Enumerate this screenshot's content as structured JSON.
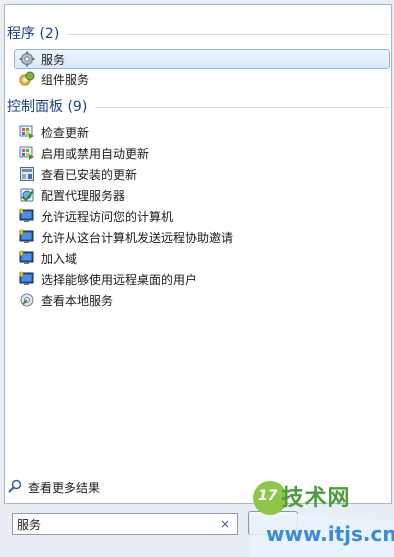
{
  "programs": {
    "header": "程序 (2)",
    "items": [
      {
        "label": "服务",
        "icon": "services-gear-icon",
        "selected": true
      },
      {
        "label": "组件服务",
        "icon": "component-services-icon",
        "selected": false
      }
    ]
  },
  "control_panel": {
    "header": "控制面板 (9)",
    "items": [
      {
        "label": "检查更新",
        "icon": "windows-update-icon"
      },
      {
        "label": "启用或禁用自动更新",
        "icon": "windows-update-icon"
      },
      {
        "label": "查看已安装的更新",
        "icon": "installed-updates-icon"
      },
      {
        "label": "配置代理服务器",
        "icon": "internet-options-icon"
      },
      {
        "label": "允许远程访问您的计算机",
        "icon": "system-shield-icon"
      },
      {
        "label": "允许从这台计算机发送远程协助邀请",
        "icon": "system-shield-icon"
      },
      {
        "label": "加入域",
        "icon": "system-shield-icon"
      },
      {
        "label": "选择能够使用远程桌面的用户",
        "icon": "system-shield-icon"
      },
      {
        "label": "查看本地服务",
        "icon": "admin-tools-icon"
      }
    ]
  },
  "footer": {
    "more_results": "查看更多结果",
    "search_value": "服务",
    "clear_glyph": "×"
  },
  "watermark": {
    "logo_num": "17",
    "logo_text": "技术网",
    "url": "www.itjs.cn"
  },
  "colors": {
    "header_text": "#1e3f8c",
    "selected_bg": "#d9e8fa",
    "selected_border": "#8fb4e0"
  }
}
